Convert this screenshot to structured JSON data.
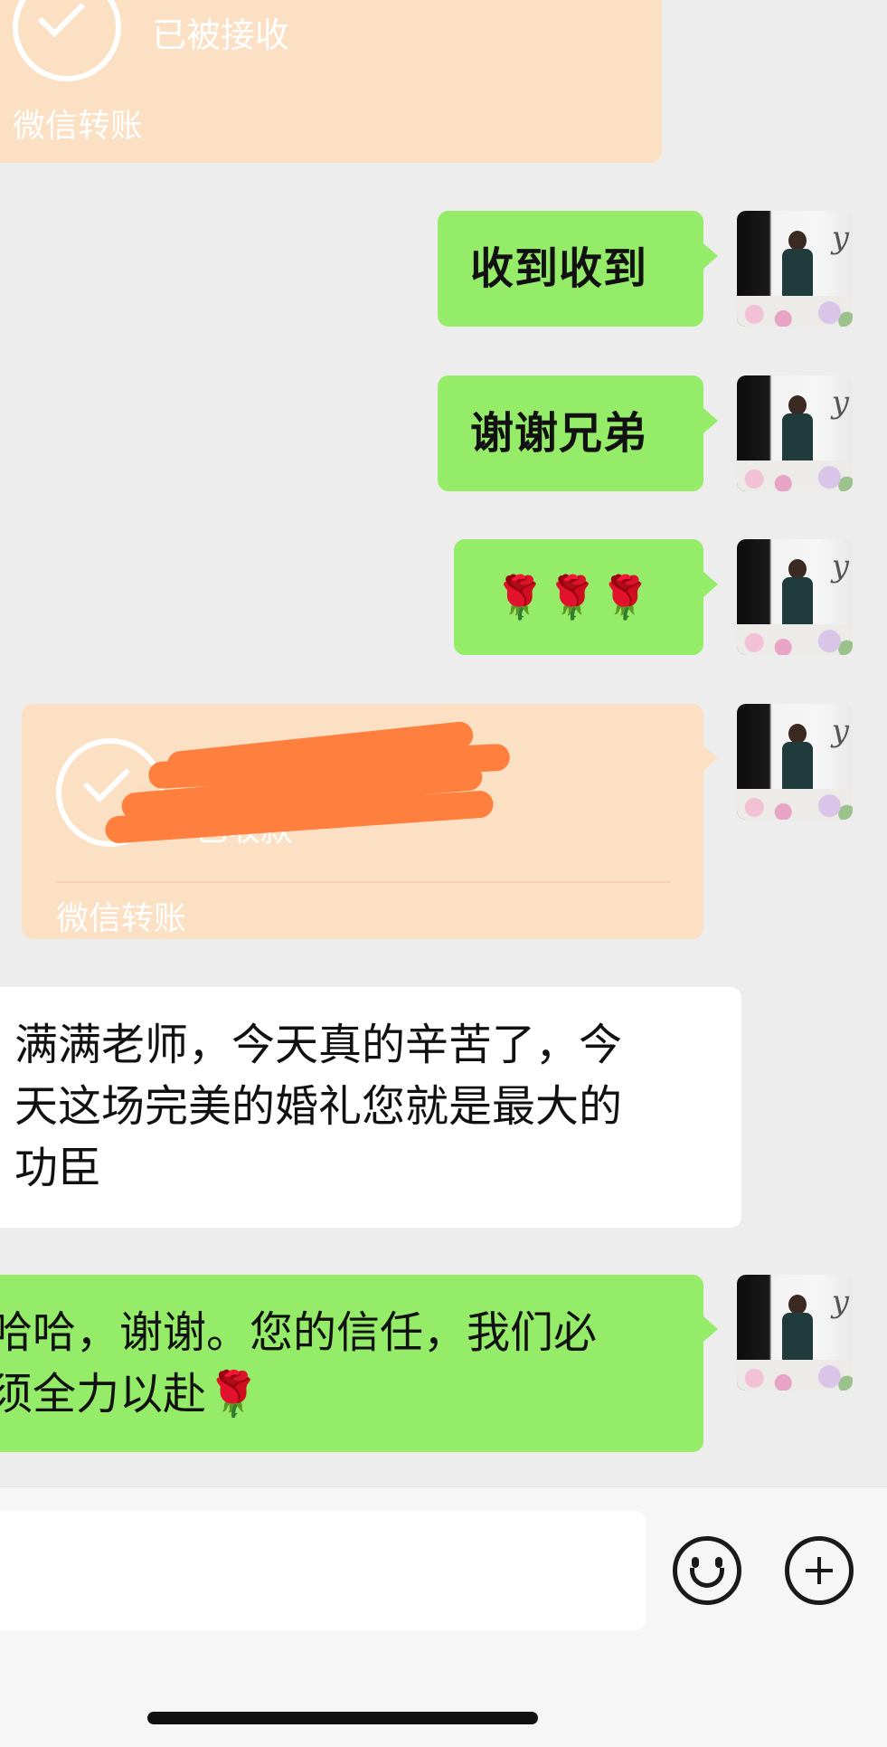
{
  "messages": {
    "top_transfer": {
      "status": "已被接收",
      "footer": "微信转账"
    },
    "m1": "收到收到",
    "m2": "谢谢兄弟",
    "m3": "🌹🌹🌹",
    "transfer2": {
      "status": "已收款",
      "footer": "微信转账"
    },
    "incoming": {
      "line1": "满满老师，今天真的辛苦了，今",
      "line2": "天这场完美的婚礼您就是最大的",
      "line3": "功臣"
    },
    "m4": {
      "line1": "哈哈，谢谢。您的信任，我们必",
      "line2": "须全力以赴🌹"
    }
  },
  "input_bar": {
    "text_placeholder": "",
    "emoji_icon": "emoji-icon",
    "plus_icon": "plus-icon"
  },
  "colors": {
    "background": "#ededed",
    "bubble_green": "#95ec69",
    "transfer_bg": "#fce0c4",
    "redaction": "#ff7f3e"
  }
}
